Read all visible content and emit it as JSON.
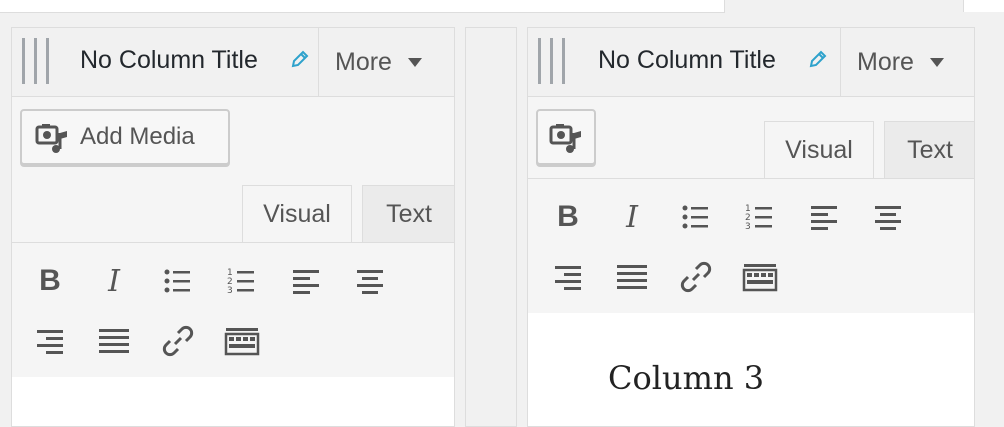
{
  "columns": [
    {
      "title": "No Column Title",
      "more_label": "More",
      "add_media_label": "Add Media",
      "tabs": [
        {
          "label": "Visual",
          "active": true
        },
        {
          "label": "Text",
          "active": false
        }
      ],
      "toolbar": [
        "bold-icon",
        "italic-icon",
        "bulleted-list-icon",
        "numbered-list-icon",
        "align-left-icon",
        "align-center-icon",
        "align-right-icon",
        "justify-icon",
        "link-icon",
        "toolbar-toggle-icon"
      ],
      "content": ""
    },
    {
      "title": "No Column Title",
      "more_label": "More",
      "add_media_label": "",
      "tabs": [
        {
          "label": "Visual",
          "active": true
        },
        {
          "label": "Text",
          "active": false
        }
      ],
      "toolbar": [
        "bold-icon",
        "italic-icon",
        "bulleted-list-icon",
        "numbered-list-icon",
        "align-left-icon",
        "align-center-icon",
        "align-right-icon",
        "justify-icon",
        "link-icon",
        "toolbar-toggle-icon"
      ],
      "content": "Column 3"
    }
  ],
  "colors": {
    "icon": "#555555",
    "edit_icon": "#2ea2cc",
    "border": "#dddddd",
    "panel": "#f5f5f5"
  }
}
